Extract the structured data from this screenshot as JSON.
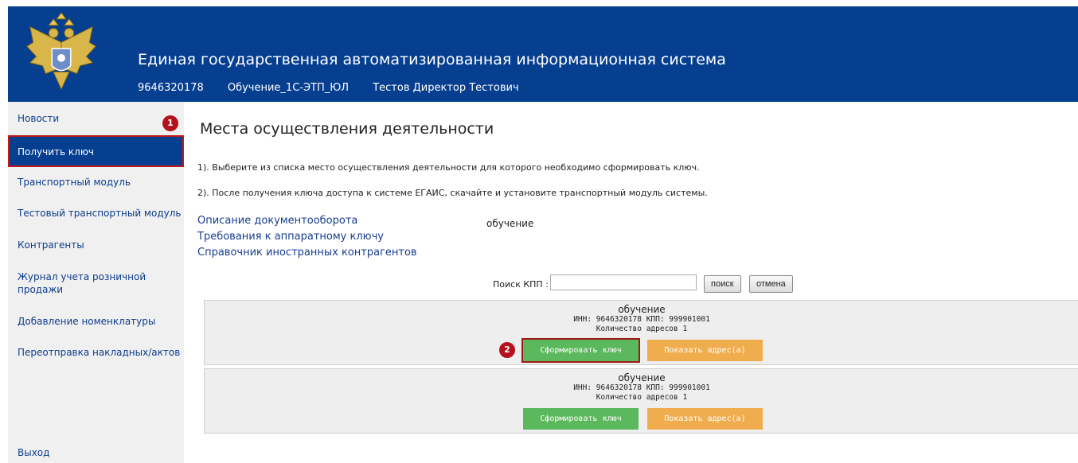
{
  "header": {
    "title": "Единая государственная автоматизированная информационная система",
    "inn": "9646320178",
    "org": "Обучение_1С-ЭТП_ЮЛ",
    "user": "Тестов Директор Тестович"
  },
  "sidebar": {
    "items": [
      {
        "label": "Новости"
      },
      {
        "label": "Получить ключ"
      },
      {
        "label": "Транспортный модуль"
      },
      {
        "label": "Тестовый транспортный модуль"
      },
      {
        "label": "Контрагенты"
      },
      {
        "label": "Журнал учета розничной продажи"
      },
      {
        "label": "Добавление номенклатуры"
      },
      {
        "label": "Переотправка накладных/актов"
      }
    ],
    "logout": "Выход"
  },
  "badges": {
    "one": "1",
    "two": "2"
  },
  "main": {
    "title": "Места осуществления деятельности",
    "instruction1": "1). Выберите из списка место осуществления деятельности для которого необходимо сформировать ключ.",
    "instruction2": "2). После получения ключа доступа к системе ЕГАИС, скачайте и установите транспортный модуль системы.",
    "links": [
      "Описание документооборота",
      "Требования к аппаратному ключу",
      "Справочник иностранных контрагентов"
    ],
    "top_label": "обучение",
    "search": {
      "label": "Поиск КПП :",
      "value": "",
      "search_btn": "поиск",
      "cancel_btn": "отмена"
    },
    "cards": [
      {
        "name": "обучение",
        "ids": "ИНН: 9646320178 КПП: 999901001",
        "count": "Количество адресов 1",
        "btn_key": "Сформировать ключ",
        "btn_addr": "Показать адрес(а)"
      },
      {
        "name": "обучение",
        "ids": "ИНН: 9646320178 КПП: 999901001",
        "count": "Количество адресов 1",
        "btn_key": "Сформировать ключ",
        "btn_addr": "Показать адрес(а)"
      }
    ]
  },
  "colors": {
    "header_bg": "#063f8f",
    "sidebar_bg": "#f0f0f0",
    "green": "#5cb85c",
    "orange": "#f0ad4e",
    "badge": "#b3111c"
  },
  "icons": {
    "emblem": "double-headed-eagle-emblem-icon"
  }
}
